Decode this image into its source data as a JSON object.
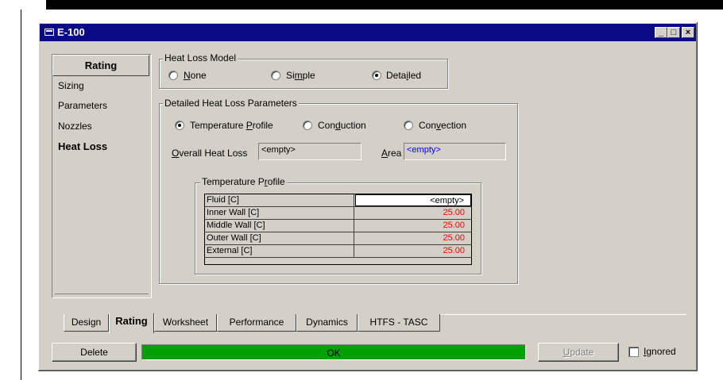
{
  "window": {
    "title": "E-100"
  },
  "sidebar": {
    "header": "Rating",
    "items": [
      {
        "label": "Sizing",
        "active": false
      },
      {
        "label": "Parameters",
        "active": false
      },
      {
        "label": "Nozzles",
        "active": false
      },
      {
        "label": "Heat Loss",
        "active": true
      }
    ]
  },
  "heat_loss_model": {
    "group_label": "Heat Loss Model",
    "options": [
      {
        "label": "None",
        "checked": false
      },
      {
        "label": "Simple",
        "checked": false
      },
      {
        "label": "Detailed",
        "checked": true
      }
    ]
  },
  "detailed_params": {
    "group_label": "Detailed Heat Loss Parameters",
    "options": [
      {
        "label": "Temperature Profile",
        "checked": true
      },
      {
        "label": "Conduction",
        "checked": false
      },
      {
        "label": "Convection",
        "checked": false
      }
    ],
    "overall_heat_loss_label": "Overall Heat Loss",
    "overall_heat_loss_value": "<empty>",
    "area_label": "Area",
    "area_value": "<empty>"
  },
  "temperature_profile": {
    "group_label": "Temperature Profile",
    "rows": [
      {
        "name": "Fluid [C]",
        "value": "<empty>"
      },
      {
        "name": "Inner Wall [C]",
        "value": "25.00"
      },
      {
        "name": "Middle Wall [C]",
        "value": "25.00"
      },
      {
        "name": "Outer Wall [C]",
        "value": "25.00"
      },
      {
        "name": "External [C]",
        "value": "25.00"
      }
    ]
  },
  "tabs": [
    {
      "label": "Design",
      "active": false
    },
    {
      "label": "Rating",
      "active": true
    },
    {
      "label": "Worksheet",
      "active": false
    },
    {
      "label": "Performance",
      "active": false
    },
    {
      "label": "Dynamics",
      "active": false
    },
    {
      "label": "HTFS - TASC",
      "active": false
    }
  ],
  "footer": {
    "delete_label": "Delete",
    "status_text": "OK",
    "update_label": "Update",
    "ignored_label": "Ignored",
    "ignored_checked": false
  },
  "colors": {
    "titlebar": "#0a0a84",
    "status_ok": "#00a000",
    "value_default": "#ff0000",
    "field_text_blue": "#0000ff"
  }
}
